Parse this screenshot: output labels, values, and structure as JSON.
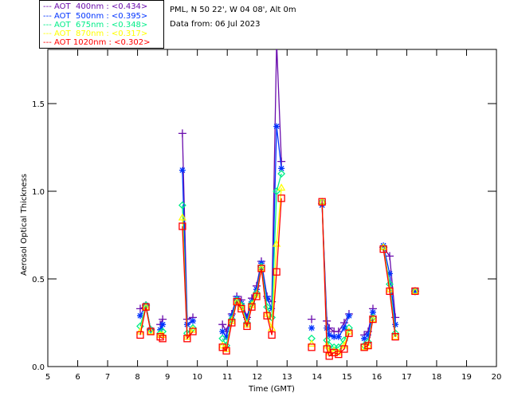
{
  "header": {
    "location": "PML, N 50 22', W 04 08', Alt 0m",
    "date": "Data from: 06 Jul 2023"
  },
  "legend": [
    {
      "label": "AOT  400nm : <0.434>",
      "color": "#6a0dad",
      "marker": "plus"
    },
    {
      "label": "AOT  500nm : <0.395>",
      "color": "#0033ff",
      "marker": "asterisk"
    },
    {
      "label": "AOT  675nm : <0.348>",
      "color": "#00ee88",
      "marker": "diamond"
    },
    {
      "label": "AOT  870nm : <0.317>",
      "color": "#ffff00",
      "marker": "triangle"
    },
    {
      "label": "AOT 1020nm : <0.302>",
      "color": "#ff0000",
      "marker": "square"
    }
  ],
  "chart_data": {
    "type": "line",
    "xlabel": "Time (GMT)",
    "ylabel": "Aerosol Optical Thickness",
    "xlim": [
      5,
      20
    ],
    "ylim": [
      0,
      1.75
    ],
    "xticks": [
      "5",
      "6",
      "7",
      "8",
      "9",
      "10",
      "11",
      "12",
      "13",
      "14",
      "15",
      "16",
      "17",
      "18",
      "19",
      "20"
    ],
    "yticks": [
      "0.0",
      "0.5",
      "1.0",
      "1.5"
    ],
    "x": [
      8.09,
      8.28,
      8.44,
      8.76,
      8.84,
      9.5,
      9.66,
      9.85,
      10.84,
      10.97,
      11.15,
      11.32,
      11.47,
      11.66,
      11.82,
      11.98,
      12.14,
      12.33,
      12.49,
      12.65,
      12.81,
      13.82,
      14.17,
      14.33,
      14.41,
      14.57,
      14.72,
      14.91,
      15.07,
      15.58,
      15.71,
      15.87,
      16.22,
      16.43,
      16.62,
      17.28
    ],
    "series": [
      {
        "name": "AOT 400nm",
        "values": [
          0.33,
          0.35,
          0.21,
          0.24,
          0.27,
          1.33,
          0.27,
          0.28,
          0.24,
          0.2,
          0.3,
          0.4,
          0.38,
          0.28,
          0.39,
          0.46,
          0.6,
          0.4,
          0.37,
          1.85,
          1.17,
          0.27,
          0.93,
          0.26,
          0.22,
          0.2,
          0.2,
          0.25,
          0.3,
          0.18,
          0.2,
          0.33,
          0.68,
          0.63,
          0.28,
          0.43
        ]
      },
      {
        "name": "AOT 500nm",
        "values": [
          0.29,
          0.35,
          0.21,
          0.21,
          0.24,
          1.12,
          0.24,
          0.26,
          0.2,
          0.17,
          0.29,
          0.39,
          0.36,
          0.27,
          0.37,
          0.44,
          0.59,
          0.39,
          0.33,
          1.37,
          1.13,
          0.22,
          0.92,
          0.22,
          0.18,
          0.17,
          0.17,
          0.22,
          0.29,
          0.16,
          0.18,
          0.31,
          0.69,
          0.53,
          0.24,
          0.43
        ]
      },
      {
        "name": "AOT 675nm",
        "values": [
          0.23,
          0.35,
          0.21,
          0.19,
          0.2,
          0.92,
          0.19,
          0.22,
          0.16,
          0.12,
          0.27,
          0.38,
          0.35,
          0.25,
          0.36,
          0.42,
          0.57,
          0.34,
          0.28,
          1.0,
          1.1,
          0.16,
          0.94,
          0.15,
          0.12,
          0.11,
          0.11,
          0.15,
          0.22,
          0.12,
          0.14,
          0.28,
          0.68,
          0.47,
          0.19,
          0.43
        ]
      },
      {
        "name": "AOT 870nm",
        "values": [
          0.2,
          0.34,
          0.2,
          0.18,
          0.18,
          0.85,
          0.17,
          0.21,
          0.12,
          0.1,
          0.26,
          0.37,
          0.34,
          0.24,
          0.35,
          0.41,
          0.56,
          0.3,
          0.22,
          0.7,
          1.02,
          0.13,
          0.94,
          0.12,
          0.08,
          0.09,
          0.08,
          0.12,
          0.2,
          0.11,
          0.12,
          0.27,
          0.68,
          0.44,
          0.17,
          0.43
        ]
      },
      {
        "name": "AOT 1020nm",
        "values": [
          0.18,
          0.34,
          0.2,
          0.17,
          0.16,
          0.8,
          0.16,
          0.2,
          0.11,
          0.09,
          0.25,
          0.37,
          0.33,
          0.23,
          0.34,
          0.4,
          0.56,
          0.29,
          0.18,
          0.54,
          0.96,
          0.11,
          0.94,
          0.1,
          0.06,
          0.08,
          0.07,
          0.1,
          0.19,
          0.11,
          0.12,
          0.27,
          0.67,
          0.43,
          0.17,
          0.43
        ]
      }
    ]
  }
}
